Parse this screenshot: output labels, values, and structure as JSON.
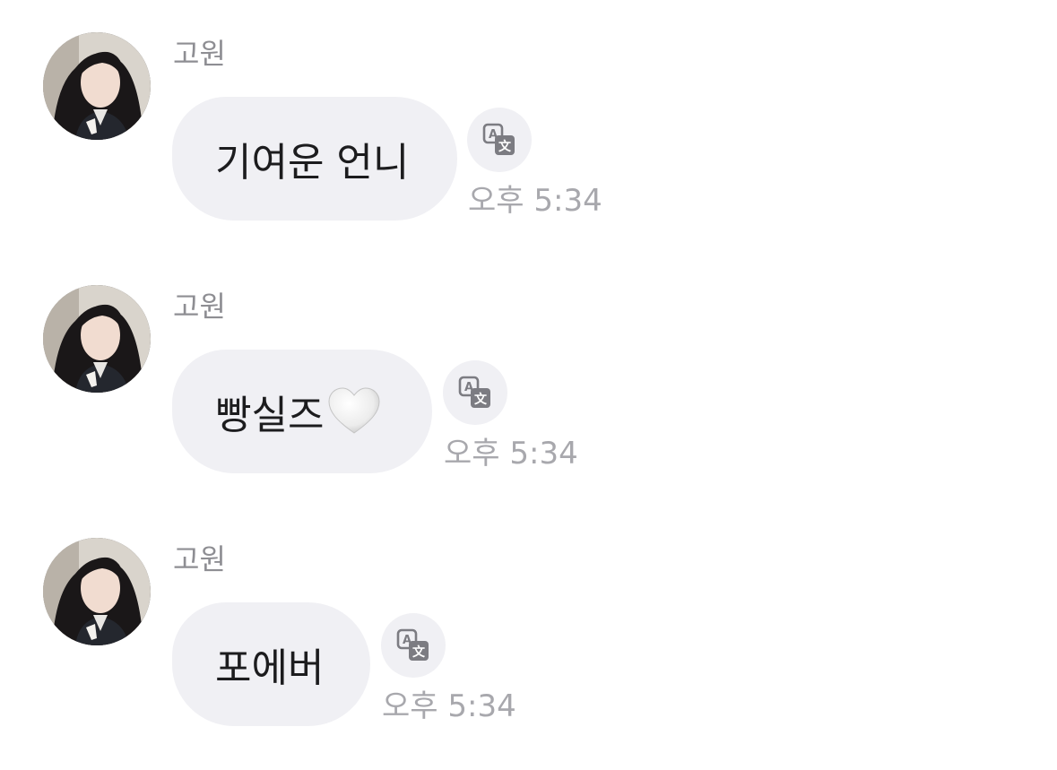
{
  "messages": [
    {
      "sender": "고원",
      "text": "기여운 언니",
      "emoji": "",
      "time": "오후 5:34"
    },
    {
      "sender": "고원",
      "text": "빵실즈",
      "emoji": "white-heart",
      "time": "오후 5:34"
    },
    {
      "sender": "고원",
      "text": "포에버",
      "emoji": "",
      "time": "오후 5:34"
    }
  ],
  "colors": {
    "bubble": "#f0f0f4",
    "sender_text": "#8e8e93",
    "time_text": "#a8a8ad",
    "message_text": "#1c1c1e",
    "icon_fill": "#7c7c82"
  },
  "icons": {
    "translate": "translate-icon",
    "avatar": "profile-photo"
  }
}
